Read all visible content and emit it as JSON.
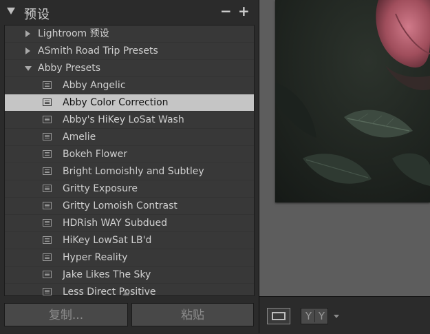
{
  "panel": {
    "title": "预设",
    "minus_label": "−",
    "plus_label": "+"
  },
  "folders": [
    {
      "label": "Lightroom 预设",
      "expanded": false
    },
    {
      "label": "ASmith Road Trip Presets",
      "expanded": false
    },
    {
      "label": "Abby Presets",
      "expanded": true
    }
  ],
  "presets": [
    {
      "label": "Abby Angelic",
      "selected": false
    },
    {
      "label": "Abby Color Correction",
      "selected": true
    },
    {
      "label": "Abby's HiKey LoSat Wash",
      "selected": false
    },
    {
      "label": "Amelie",
      "selected": false
    },
    {
      "label": "Bokeh Flower",
      "selected": false
    },
    {
      "label": "Bright Lomoishly and Subtley",
      "selected": false
    },
    {
      "label": "Gritty Exposure",
      "selected": false
    },
    {
      "label": "Gritty Lomoish Contrast",
      "selected": false
    },
    {
      "label": "HDRish WAY Subdued",
      "selected": false
    },
    {
      "label": "HiKey LowSat LB'd",
      "selected": false
    },
    {
      "label": "Hyper Reality",
      "selected": false
    },
    {
      "label": "Jake Likes The Sky",
      "selected": false
    },
    {
      "label": "Less Direct Positive",
      "selected": false
    }
  ],
  "buttons": {
    "copy_label": "复制...",
    "paste_label": "粘贴"
  },
  "toolbar": {
    "compare_label_a": "Y",
    "compare_label_b": "Y"
  },
  "colors": {
    "selected_row_bg": "#c5c5c5",
    "panel_bg": "#2b2b2b",
    "list_bg": "#383838",
    "canvas_bg": "#5d5d5d"
  }
}
